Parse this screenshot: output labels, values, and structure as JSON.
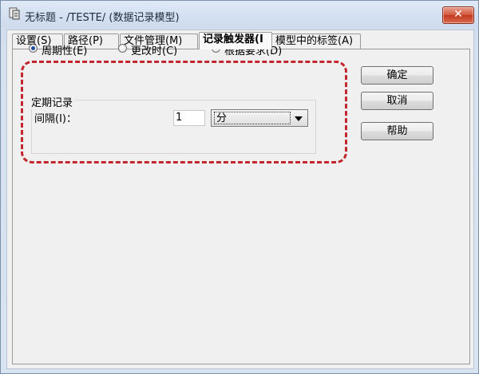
{
  "window": {
    "title": "无标题 - /TESTE/ (数据记录模型)",
    "close_glyph": "✕"
  },
  "tabs": [
    {
      "label": "设置(S)"
    },
    {
      "label": "路径(P)"
    },
    {
      "label": "文件管理(M)"
    },
    {
      "label": "记录触发器(I"
    },
    {
      "label": "模型中的标签(A)"
    }
  ],
  "trigger": {
    "options": [
      {
        "label": "周期性(E)",
        "selected": true
      },
      {
        "label": "更改时(C)",
        "selected": false
      },
      {
        "label": "根据要求(D)",
        "selected": false
      }
    ]
  },
  "periodic": {
    "group_title": "定期记录",
    "interval_label": "间隔(I)：",
    "interval_value": "1",
    "unit_value": "分"
  },
  "buttons": {
    "ok": "确定",
    "cancel": "取消",
    "help": "帮助"
  },
  "colors": {
    "highlight": "#c1272d",
    "close_button": "#c23a20"
  },
  "icons": {
    "app": "app-icon",
    "close": "close-icon",
    "dropdown": "chevron-down-icon"
  }
}
